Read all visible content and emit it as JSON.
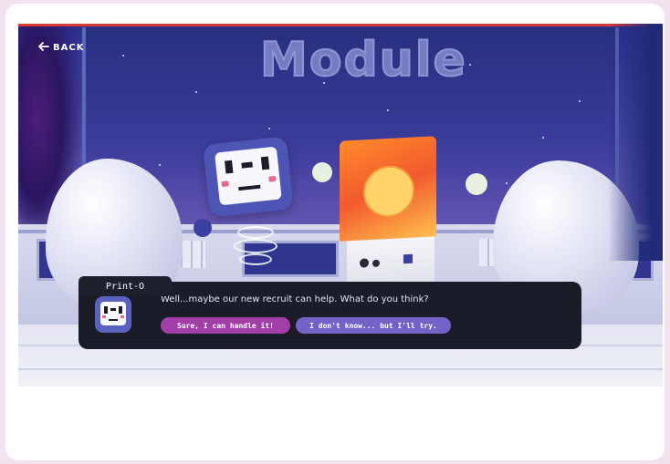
{
  "nav": {
    "back_label": "BACK",
    "back_icon": "arrow-left-icon"
  },
  "scene": {
    "sign_text": "Module"
  },
  "dialog": {
    "speaker": "Print-O",
    "message": "Well...maybe our new recruit can help. What do you think?",
    "choices": [
      {
        "label": "Sure, I can handle it!"
      },
      {
        "label": "I don't know... but I'll try."
      }
    ]
  },
  "colors": {
    "choice_primary": "#a13ea8",
    "choice_secondary": "#7462c6",
    "dialog_bg": "#1a1c28",
    "accent_red": "#d83a3a"
  }
}
